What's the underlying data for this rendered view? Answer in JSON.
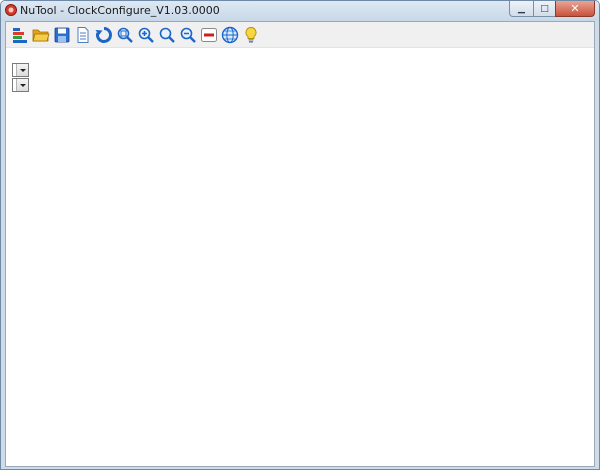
{
  "window": {
    "title": "NuTool - ClockConfigure_V1.03.0000",
    "controls": {
      "minimize_glyph": "▁",
      "maximize_glyph": "□",
      "close_glyph": "✕"
    }
  },
  "toolbar": {
    "buttons": [
      {
        "name": "chip-select-icon"
      },
      {
        "name": "open-folder-icon"
      },
      {
        "name": "save-icon"
      },
      {
        "name": "document-icon"
      },
      {
        "name": "refresh-icon"
      },
      {
        "name": "zoom-fit-icon"
      },
      {
        "name": "zoom-in-icon"
      },
      {
        "name": "zoom-reset-icon"
      },
      {
        "name": "zoom-out-icon"
      },
      {
        "name": "remove-icon"
      },
      {
        "name": "globe-icon"
      },
      {
        "name": "lightbulb-icon"
      }
    ]
  },
  "colors": {
    "toolbar_bg": "#f0f0f0",
    "content_bg": "#ffffff",
    "icon_blue": "#1c66c8",
    "folder_yellow": "#f2b81c",
    "remove_red": "#cc1f1f"
  },
  "content": {
    "dropdowns": [
      {
        "value": ""
      },
      {
        "value": ""
      }
    ]
  }
}
